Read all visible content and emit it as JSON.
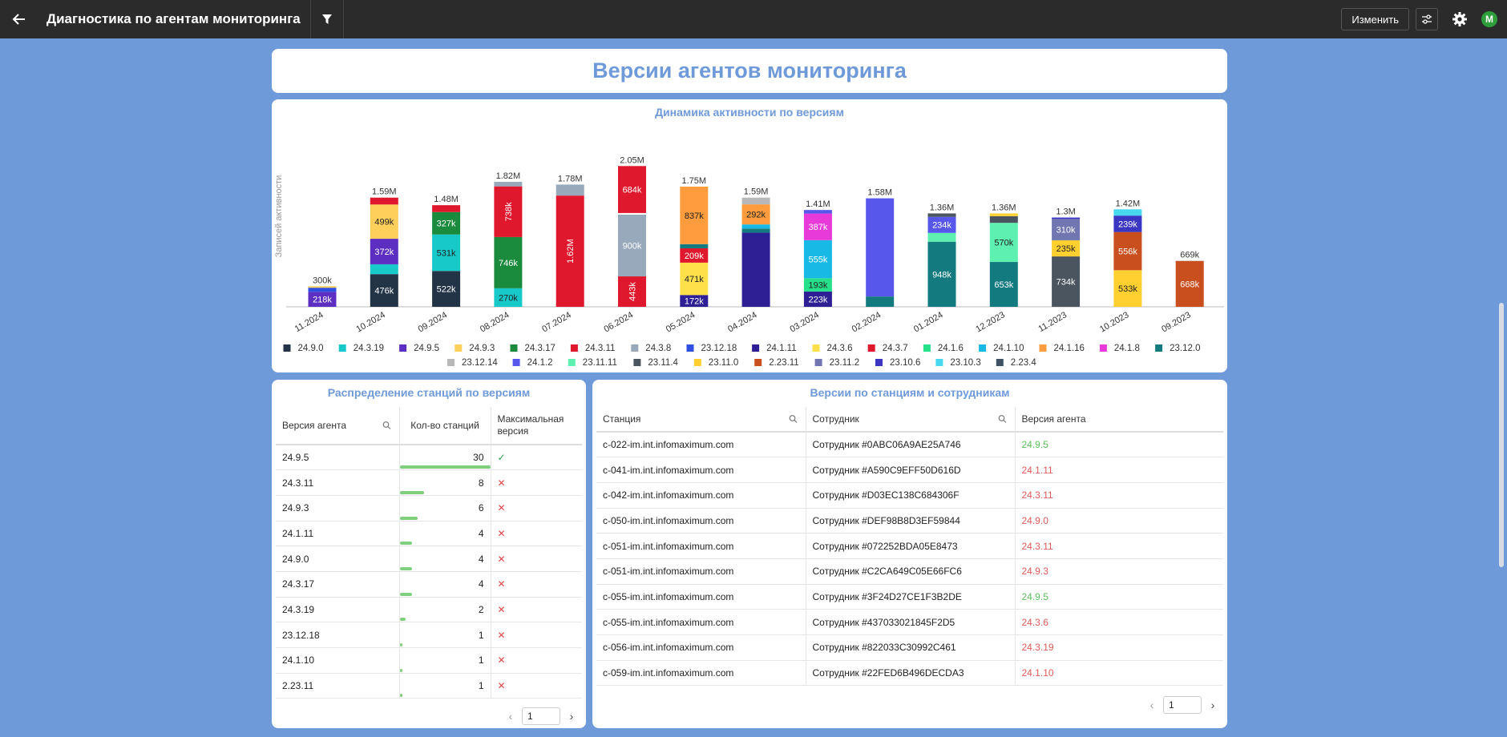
{
  "app": {
    "title": "Диагностика по агентам мониторинга",
    "edit_label": "Изменить",
    "avatar_letter": "M"
  },
  "dashboard": {
    "title": "Версии агентов мониторинга"
  },
  "chart": {
    "title": "Динамика активности по версиям"
  },
  "chart_data": {
    "type": "bar",
    "stacked": true,
    "ylabel": "Записей активности",
    "categories": [
      "11.2024",
      "10.2024",
      "09.2024",
      "08.2024",
      "07.2024",
      "06.2024",
      "05.2024",
      "04.2024",
      "03.2024",
      "02.2024",
      "01.2024",
      "12.2023",
      "11.2023",
      "10.2023",
      "09.2023"
    ],
    "totals": [
      "300k",
      "1.59M",
      "1.48M",
      "1.82M",
      "1.78M",
      "2.05M",
      "1.75M",
      "1.59M",
      "1.41M",
      "1.58M",
      "1.36M",
      "1.36M",
      "1.3M",
      "1.42M",
      "669k"
    ],
    "ylim": [
      0,
      2100000
    ],
    "legend": [
      {
        "name": "24.9.0",
        "color": "#243447"
      },
      {
        "name": "24.3.19",
        "color": "#17c9c9"
      },
      {
        "name": "24.9.5",
        "color": "#5c2fc2"
      },
      {
        "name": "24.9.3",
        "color": "#ffcf5c"
      },
      {
        "name": "24.3.17",
        "color": "#1a8a3c"
      },
      {
        "name": "24.3.11",
        "color": "#e0182d"
      },
      {
        "name": "24.3.8",
        "color": "#98a9bc"
      },
      {
        "name": "23.12.18",
        "color": "#2f4fe0"
      },
      {
        "name": "24.1.11",
        "color": "#2e2094"
      },
      {
        "name": "24.3.6",
        "color": "#ffe04b"
      },
      {
        "name": "24.3.7",
        "color": "#e0182d"
      },
      {
        "name": "24.1.6",
        "color": "#27e08a"
      },
      {
        "name": "24.1.10",
        "color": "#19b9e6"
      },
      {
        "name": "24.1.16",
        "color": "#ff9c3d"
      },
      {
        "name": "24.1.8",
        "color": "#e83ad8"
      },
      {
        "name": "23.12.0",
        "color": "#137a80"
      },
      {
        "name": "23.12.14",
        "color": "#b8b8b8"
      },
      {
        "name": "24.1.2",
        "color": "#5757ec"
      },
      {
        "name": "23.11.11",
        "color": "#5ef0b0"
      },
      {
        "name": "23.11.4",
        "color": "#4a5560"
      },
      {
        "name": "23.11.0",
        "color": "#ffd030"
      },
      {
        "name": "2.23.11",
        "color": "#c9501e"
      },
      {
        "name": "23.11.2",
        "color": "#7276b0"
      },
      {
        "name": "23.10.6",
        "color": "#3a36c2"
      },
      {
        "name": "23.10.3",
        "color": "#48d8f0"
      },
      {
        "name": "2.23.4",
        "color": "#3e5264"
      }
    ],
    "stacks": [
      [
        {
          "v": 218000,
          "c": "#5c2fc2",
          "l": "218k"
        },
        {
          "v": 60000,
          "c": "#2f4fe0",
          "l": ""
        },
        {
          "v": 22000,
          "c": "#ffcf5c",
          "l": ""
        }
      ],
      [
        {
          "v": 476000,
          "c": "#243447",
          "l": "476k"
        },
        {
          "v": 143000,
          "c": "#17c9c9",
          "l": ""
        },
        {
          "v": 372000,
          "c": "#5c2fc2",
          "l": "372k"
        },
        {
          "v": 499000,
          "c": "#ffcf5c",
          "l": "499k"
        },
        {
          "v": 100000,
          "c": "#e0182d",
          "l": ""
        }
      ],
      [
        {
          "v": 522000,
          "c": "#243447",
          "l": "522k"
        },
        {
          "v": 531000,
          "c": "#17c9c9",
          "l": "531k"
        },
        {
          "v": 327000,
          "c": "#1a8a3c",
          "l": "327k"
        },
        {
          "v": 100000,
          "c": "#e0182d",
          "l": ""
        }
      ],
      [
        {
          "v": 270000,
          "c": "#17c9c9",
          "l": "270k"
        },
        {
          "v": 746000,
          "c": "#1a8a3c",
          "l": "746k"
        },
        {
          "v": 738000,
          "c": "#e0182d",
          "l": "738k",
          "rot": true
        },
        {
          "v": 66000,
          "c": "#98a9bc",
          "l": ""
        }
      ],
      [
        {
          "v": 1620000,
          "c": "#e0182d",
          "l": "1.62M",
          "rot": true
        },
        {
          "v": 160000,
          "c": "#98a9bc",
          "l": ""
        }
      ],
      [
        {
          "v": 443000,
          "c": "#e0182d",
          "l": "443k",
          "rot": true
        },
        {
          "v": 900000,
          "c": "#98a9bc",
          "l": "900k"
        },
        {
          "v": 23000,
          "c": "#ffffff",
          "l": ""
        },
        {
          "v": 684000,
          "c": "#e0182d",
          "l": "684k"
        }
      ],
      [
        {
          "v": 172000,
          "c": "#2e2094",
          "l": "172k"
        },
        {
          "v": 471000,
          "c": "#ffe04b",
          "l": "471k"
        },
        {
          "v": 209000,
          "c": "#e0182d",
          "l": "209k"
        },
        {
          "v": 61000,
          "c": "#137a80",
          "l": ""
        },
        {
          "v": 837000,
          "c": "#ff9c3d",
          "l": "837k"
        }
      ],
      [
        {
          "v": 1080000,
          "c": "#2e2094",
          "l": ""
        },
        {
          "v": 60000,
          "c": "#137a80",
          "l": ""
        },
        {
          "v": 60000,
          "c": "#19b9e6",
          "l": ""
        },
        {
          "v": 292000,
          "c": "#ff9c3d",
          "l": "292k"
        },
        {
          "v": 98000,
          "c": "#b8b8b8",
          "l": ""
        }
      ],
      [
        {
          "v": 223000,
          "c": "#2e2094",
          "l": "223k"
        },
        {
          "v": 193000,
          "c": "#27e08a",
          "l": "193k"
        },
        {
          "v": 555000,
          "c": "#19b9e6",
          "l": "555k"
        },
        {
          "v": 387000,
          "c": "#e83ad8",
          "l": "387k"
        },
        {
          "v": 52000,
          "c": "#5757ec",
          "l": ""
        }
      ],
      [
        {
          "v": 150000,
          "c": "#137a80",
          "l": ""
        },
        {
          "v": 1430000,
          "c": "#5757ec",
          "l": ""
        }
      ],
      [
        {
          "v": 948000,
          "c": "#137a80",
          "l": "948k"
        },
        {
          "v": 128000,
          "c": "#5ef0b0",
          "l": ""
        },
        {
          "v": 234000,
          "c": "#5757ec",
          "l": "234k"
        },
        {
          "v": 50000,
          "c": "#4a5560",
          "l": ""
        }
      ],
      [
        {
          "v": 653000,
          "c": "#137a80",
          "l": "653k"
        },
        {
          "v": 570000,
          "c": "#5ef0b0",
          "l": "570k"
        },
        {
          "v": 97000,
          "c": "#4a5560",
          "l": ""
        },
        {
          "v": 40000,
          "c": "#ffd030",
          "l": ""
        }
      ],
      [
        {
          "v": 734000,
          "c": "#4a5560",
          "l": "734k"
        },
        {
          "v": 235000,
          "c": "#ffd030",
          "l": "235k"
        },
        {
          "v": 310000,
          "c": "#7276b0",
          "l": "310k"
        },
        {
          "v": 21000,
          "c": "#3a36c2",
          "l": ""
        }
      ],
      [
        {
          "v": 533000,
          "c": "#ffd030",
          "l": "533k"
        },
        {
          "v": 556000,
          "c": "#c9501e",
          "l": "556k"
        },
        {
          "v": 239000,
          "c": "#3a36c2",
          "l": "239k"
        },
        {
          "v": 92000,
          "c": "#48d8f0",
          "l": ""
        }
      ],
      [
        {
          "v": 668000,
          "c": "#c9501e",
          "l": "668k"
        },
        {
          "v": 1000,
          "c": "#3e5264",
          "l": ""
        }
      ]
    ]
  },
  "stations_dist": {
    "title": "Распределение станций по версиям",
    "headers": [
      "Версия агента",
      "Кол-во станций",
      "Максимальная версия"
    ],
    "max": 30,
    "rows": [
      {
        "version": "24.9.5",
        "count": 30,
        "is_max": true
      },
      {
        "version": "24.3.11",
        "count": 8,
        "is_max": false
      },
      {
        "version": "24.9.3",
        "count": 6,
        "is_max": false
      },
      {
        "version": "24.1.11",
        "count": 4,
        "is_max": false
      },
      {
        "version": "24.9.0",
        "count": 4,
        "is_max": false
      },
      {
        "version": "24.3.17",
        "count": 4,
        "is_max": false
      },
      {
        "version": "24.3.19",
        "count": 2,
        "is_max": false
      },
      {
        "version": "23.12.18",
        "count": 1,
        "is_max": false
      },
      {
        "version": "24.1.10",
        "count": 1,
        "is_max": false
      },
      {
        "version": "2.23.11",
        "count": 1,
        "is_max": false
      }
    ],
    "check_mark": "✓",
    "cross_mark": "✕",
    "page": "1"
  },
  "stations_users": {
    "title": "Версии по станциям и сотрудникам",
    "headers": [
      "Станция",
      "Сотрудник",
      "Версия агента"
    ],
    "rows": [
      {
        "station": "c-022-im.int.infomaximum.com",
        "user": "Сотрудник #0ABC06A9AE25A746",
        "version": "24.9.5",
        "latest": true
      },
      {
        "station": "c-041-im.int.infomaximum.com",
        "user": "Сотрудник #A590C9EFF50D616D",
        "version": "24.1.11",
        "latest": false
      },
      {
        "station": "c-042-im.int.infomaximum.com",
        "user": "Сотрудник #D03EC138C684306F",
        "version": "24.3.11",
        "latest": false
      },
      {
        "station": "c-050-im.int.infomaximum.com",
        "user": "Сотрудник #DEF98B8D3EF59844",
        "version": "24.9.0",
        "latest": false
      },
      {
        "station": "c-051-im.int.infomaximum.com",
        "user": "Сотрудник #072252BDA05E8473",
        "version": "24.3.11",
        "latest": false
      },
      {
        "station": "c-051-im.int.infomaximum.com",
        "user": "Сотрудник #C2CA649C05E66FC6",
        "version": "24.9.3",
        "latest": false
      },
      {
        "station": "c-055-im.int.infomaximum.com",
        "user": "Сотрудник #3F24D27CE1F3B2DE",
        "version": "24.9.5",
        "latest": true
      },
      {
        "station": "c-055-im.int.infomaximum.com",
        "user": "Сотрудник #437033021845F2D5",
        "version": "24.3.6",
        "latest": false
      },
      {
        "station": "c-056-im.int.infomaximum.com",
        "user": "Сотрудник #822033C30992C461",
        "version": "24.3.19",
        "latest": false
      },
      {
        "station": "c-059-im.int.infomaximum.com",
        "user": "Сотрудник #22FED6B496DECDA3",
        "version": "24.1.10",
        "latest": false
      }
    ],
    "page": "1"
  }
}
